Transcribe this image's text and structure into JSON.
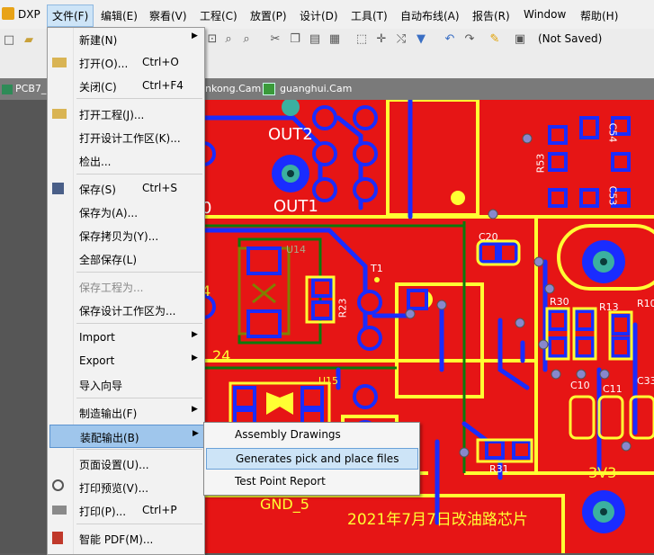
{
  "menubar": {
    "app": "DXP",
    "items": [
      "文件(F)",
      "编辑(E)",
      "察看(V)",
      "工程(C)",
      "放置(P)",
      "设计(D)",
      "工具(T)",
      "自动布线(A)",
      "报告(R)",
      "Window",
      "帮助(H)"
    ]
  },
  "toolbar": {
    "status": "(Not Saved)"
  },
  "tabs": {
    "first": "PCB7_",
    "second": "nkong.Cam",
    "third": "guanghui.Cam"
  },
  "file_menu": {
    "new": "新建(N)",
    "open": "打开(O)...",
    "open_sc": "Ctrl+O",
    "close": "关闭(C)",
    "close_sc": "Ctrl+F4",
    "open_project": "打开工程(J)...",
    "open_workspace": "打开设计工作区(K)...",
    "checkout": "检出...",
    "save": "保存(S)",
    "save_sc": "Ctrl+S",
    "save_as": "保存为(A)...",
    "save_copy_as": "保存拷贝为(Y)...",
    "save_all": "全部保存(L)",
    "save_project_as": "保存工程为...",
    "save_workspace_as": "保存设计工作区为...",
    "import": "Import",
    "export": "Export",
    "import_wizard": "导入向导",
    "fab_outputs": "制造输出(F)",
    "assembly_outputs": "装配输出(B)",
    "page_setup": "页面设置(U)...",
    "print_preview": "打印预览(V)...",
    "print": "打印(P)...",
    "print_sc": "Ctrl+P",
    "smart_pdf": "智能 PDF(M)..."
  },
  "assembly_submenu": {
    "items": [
      "Assembly Drawings",
      "Generates pick and place files",
      "Test Point Report"
    ]
  },
  "pcb": {
    "labels": {
      "out2": "OUT2",
      "out1": "OUT1",
      "u14": "U14",
      "t1": "T1",
      "r23": "R23",
      "c20": "C20",
      "r30": "R30",
      "r13": "R13",
      "r10": "R10",
      "c10": "C10",
      "c11": "C11",
      "c33": "C33",
      "u15": "U15",
      "r31": "R31",
      "v3v3": "3V3",
      "gnd5": "GND_5",
      "n24": "24",
      "n4": "4",
      "c54": "C54",
      "c53": "C53",
      "r53": "R53",
      "o": "0",
      "banner": "2021年7月7日改油路芯片"
    }
  },
  "colors": {
    "board": "#e61515",
    "track": "#ffff33",
    "pad": "#1a2cff",
    "highlight": "#9fc6ec"
  }
}
